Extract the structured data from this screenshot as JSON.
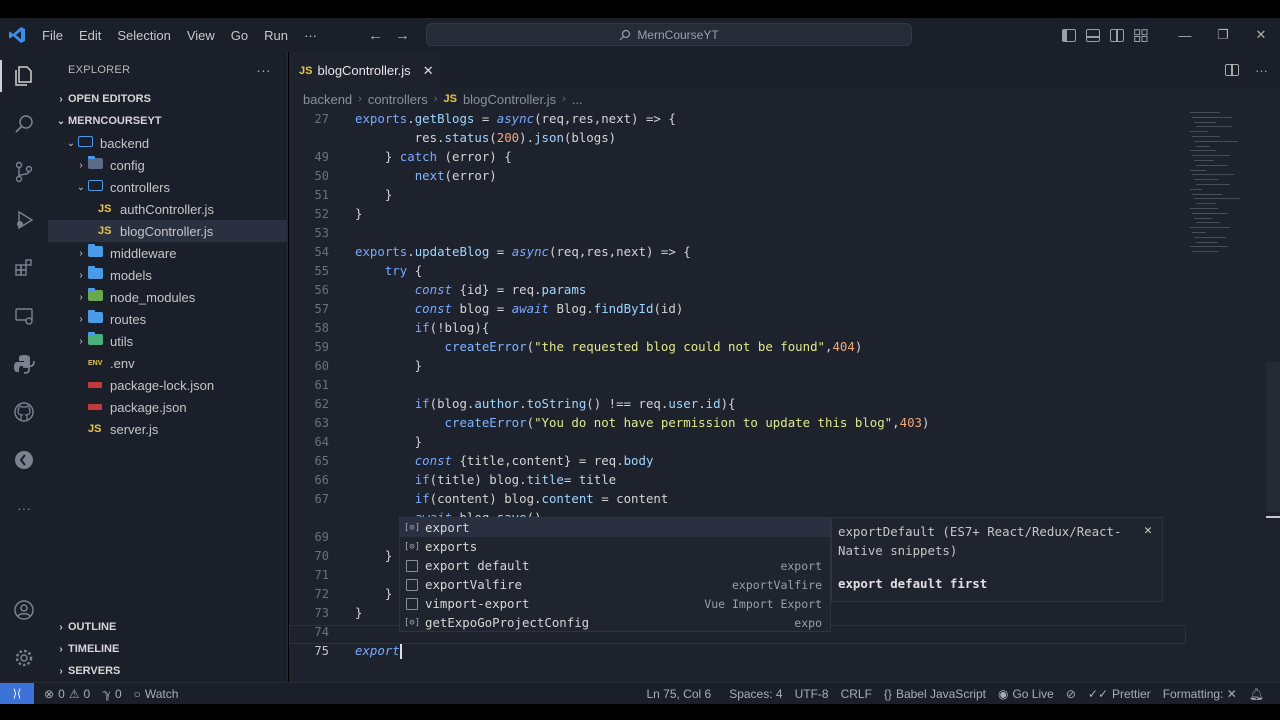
{
  "titlebar": {
    "menu": [
      "File",
      "Edit",
      "Selection",
      "View",
      "Go",
      "Run"
    ],
    "menu_more": "···",
    "search_text": "MernCourseYT",
    "window_controls": [
      "—",
      "❐",
      "✕"
    ]
  },
  "sidebar": {
    "title": "EXPLORER",
    "more": "···",
    "open_editors": "OPEN EDITORS",
    "workspace": "MERNCOURSEYT",
    "tree": [
      {
        "label": "backend",
        "type": "folder-open",
        "indent": 1,
        "chev": "⌄"
      },
      {
        "label": "config",
        "type": "folder-img",
        "indent": 2,
        "chev": "›"
      },
      {
        "label": "controllers",
        "type": "folder-open",
        "indent": 2,
        "chev": "⌄"
      },
      {
        "label": "authController.js",
        "type": "js",
        "indent": 3,
        "chev": ""
      },
      {
        "label": "blogController.js",
        "type": "js",
        "indent": 3,
        "chev": "",
        "selected": true
      },
      {
        "label": "middleware",
        "type": "folder",
        "indent": 2,
        "chev": "›"
      },
      {
        "label": "models",
        "type": "folder",
        "indent": 2,
        "chev": "›"
      },
      {
        "label": "node_modules",
        "type": "folder-node",
        "indent": 2,
        "chev": "›"
      },
      {
        "label": "routes",
        "type": "folder",
        "indent": 2,
        "chev": "›"
      },
      {
        "label": "utils",
        "type": "folder-utils",
        "indent": 2,
        "chev": "›"
      },
      {
        "label": ".env",
        "type": "env",
        "indent": 2,
        "chev": ""
      },
      {
        "label": "package-lock.json",
        "type": "npm",
        "indent": 2,
        "chev": ""
      },
      {
        "label": "package.json",
        "type": "npm",
        "indent": 2,
        "chev": ""
      },
      {
        "label": "server.js",
        "type": "js",
        "indent": 2,
        "chev": ""
      }
    ],
    "bottom_sections": [
      "OUTLINE",
      "TIMELINE",
      "SERVERS"
    ]
  },
  "editor": {
    "tab": {
      "icon": "JS",
      "label": "blogController.js",
      "close": "✕"
    },
    "actions_more": "···",
    "breadcrumb": [
      "backend",
      "controllers",
      "JS",
      "blogController.js",
      "..."
    ],
    "lines": [
      {
        "n": "27",
        "code": "exports.getBlogs = async(req,res,next) => {"
      },
      {
        "n": "",
        "code": "        res.status(200).json(blogs)"
      },
      {
        "n": "49",
        "code": "    } catch (error) {"
      },
      {
        "n": "50",
        "code": "        next(error)"
      },
      {
        "n": "51",
        "code": "    }"
      },
      {
        "n": "52",
        "code": "}"
      },
      {
        "n": "53",
        "code": ""
      },
      {
        "n": "54",
        "code": "exports.updateBlog = async(req,res,next) => {"
      },
      {
        "n": "55",
        "code": "    try {"
      },
      {
        "n": "56",
        "code": "        const {id} = req.params"
      },
      {
        "n": "57",
        "code": "        const blog = await Blog.findById(id)"
      },
      {
        "n": "58",
        "code": "        if(!blog){"
      },
      {
        "n": "59",
        "code": "            createError(\"the requested blog could not be found\",404)"
      },
      {
        "n": "60",
        "code": "        }"
      },
      {
        "n": "61",
        "code": ""
      },
      {
        "n": "62",
        "code": "        if(blog.author.toString() !== req.user.id){"
      },
      {
        "n": "63",
        "code": "            createError(\"You do not have permission to update this blog\",403)"
      },
      {
        "n": "64",
        "code": "        }"
      },
      {
        "n": "65",
        "code": "        const {title,content} = req.body"
      },
      {
        "n": "66",
        "code": "        if(title) blog.title= title"
      },
      {
        "n": "67",
        "code": "        if(content) blog.content = content"
      },
      {
        "n": "",
        "code": "        await blog.save()"
      },
      {
        "n": "69",
        "code": ""
      },
      {
        "n": "70",
        "code": "    }"
      },
      {
        "n": "71",
        "code": ""
      },
      {
        "n": "72",
        "code": "    }"
      },
      {
        "n": "73",
        "code": "}"
      },
      {
        "n": "74",
        "code": ""
      },
      {
        "n": "75",
        "code": "export"
      }
    ],
    "suggest": [
      {
        "label": "export",
        "detail": "",
        "icon": "module"
      },
      {
        "label": "exports",
        "detail": "",
        "icon": "module"
      },
      {
        "label": "export default",
        "detail": "export",
        "icon": "snippet"
      },
      {
        "label": "exportValfire",
        "detail": "exportValfire",
        "icon": "snippet"
      },
      {
        "label": "vimport-export",
        "detail": "Vue Import Export",
        "icon": "snippet"
      },
      {
        "label": "getExpoGoProjectConfig",
        "detail": "expo",
        "icon": "module"
      }
    ],
    "suggest_detail": {
      "description": "exportDefault (ES7+ React/Redux/React-Native snippets)",
      "doc": "export default first",
      "close": "✕"
    }
  },
  "statusbar": {
    "remote": "⟩⟨",
    "errors": "0",
    "warnings": "0",
    "ports": "0",
    "watch": "Watch",
    "position": "Ln 75, Col 6",
    "spaces": "Spaces: 4",
    "encoding": "UTF-8",
    "eol": "CRLF",
    "language": "Babel JavaScript",
    "golive": "Go Live",
    "prettier": "Prettier",
    "formatting": "Formatting: ✕"
  }
}
